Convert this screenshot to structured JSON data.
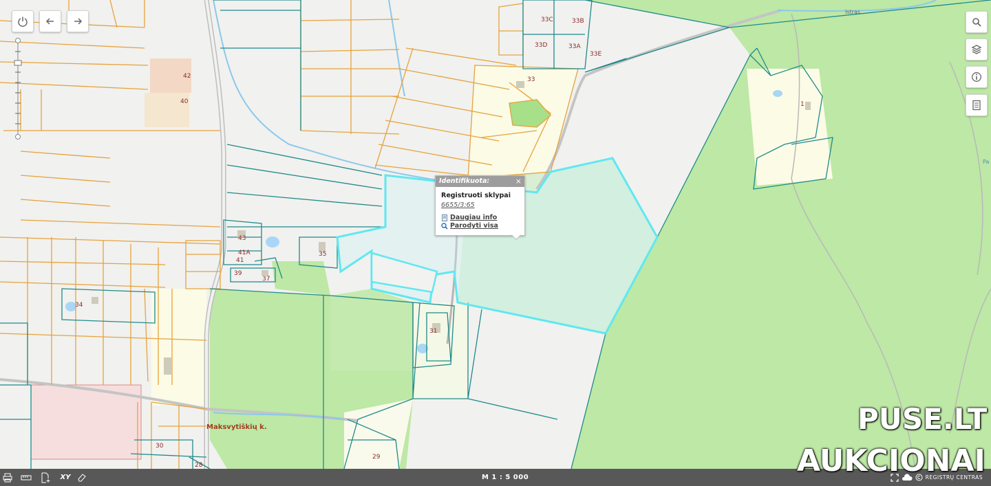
{
  "map": {
    "scale_label": "M 1 : 5 000",
    "settlement": "Maksvytiškių k.",
    "road_label": "Istras",
    "edge_label": "Pa",
    "parcels": [
      "42",
      "40",
      "43",
      "41A",
      "41",
      "39",
      "37",
      "35",
      "34",
      "33C",
      "33B",
      "33D",
      "33A",
      "33E",
      "33",
      "1",
      "31",
      "29",
      "30",
      "28"
    ]
  },
  "popup": {
    "header": "Identifikuota:",
    "close": "×",
    "title": "Registruoti sklypai",
    "cadastral": "6655/3:65",
    "more_info": "Daugiau info",
    "show_all": "Parodyti visa"
  },
  "footer": {
    "org": "REGISTRŲ CENTRAS"
  },
  "watermark": {
    "line1": "PUSE.LT",
    "line2": "AUKCIONAI"
  },
  "icons": {
    "top_left": [
      "power-icon",
      "back-arrow-icon",
      "forward-arrow-icon"
    ],
    "right": [
      "search-icon",
      "layers-icon",
      "info-icon",
      "legend-icon"
    ],
    "bottom": [
      "print-icon",
      "measure-icon",
      "add-document-icon",
      "xy-coordinates-icon",
      "eraser-icon",
      "fullscreen-icon",
      "cloud-icon",
      "copyright-icon"
    ]
  },
  "colors": {
    "forest": "#bde8a5",
    "selection": "#5fe8f0",
    "parcel_orange": "#e6a23c",
    "parcel_teal": "#1f8a8a"
  }
}
